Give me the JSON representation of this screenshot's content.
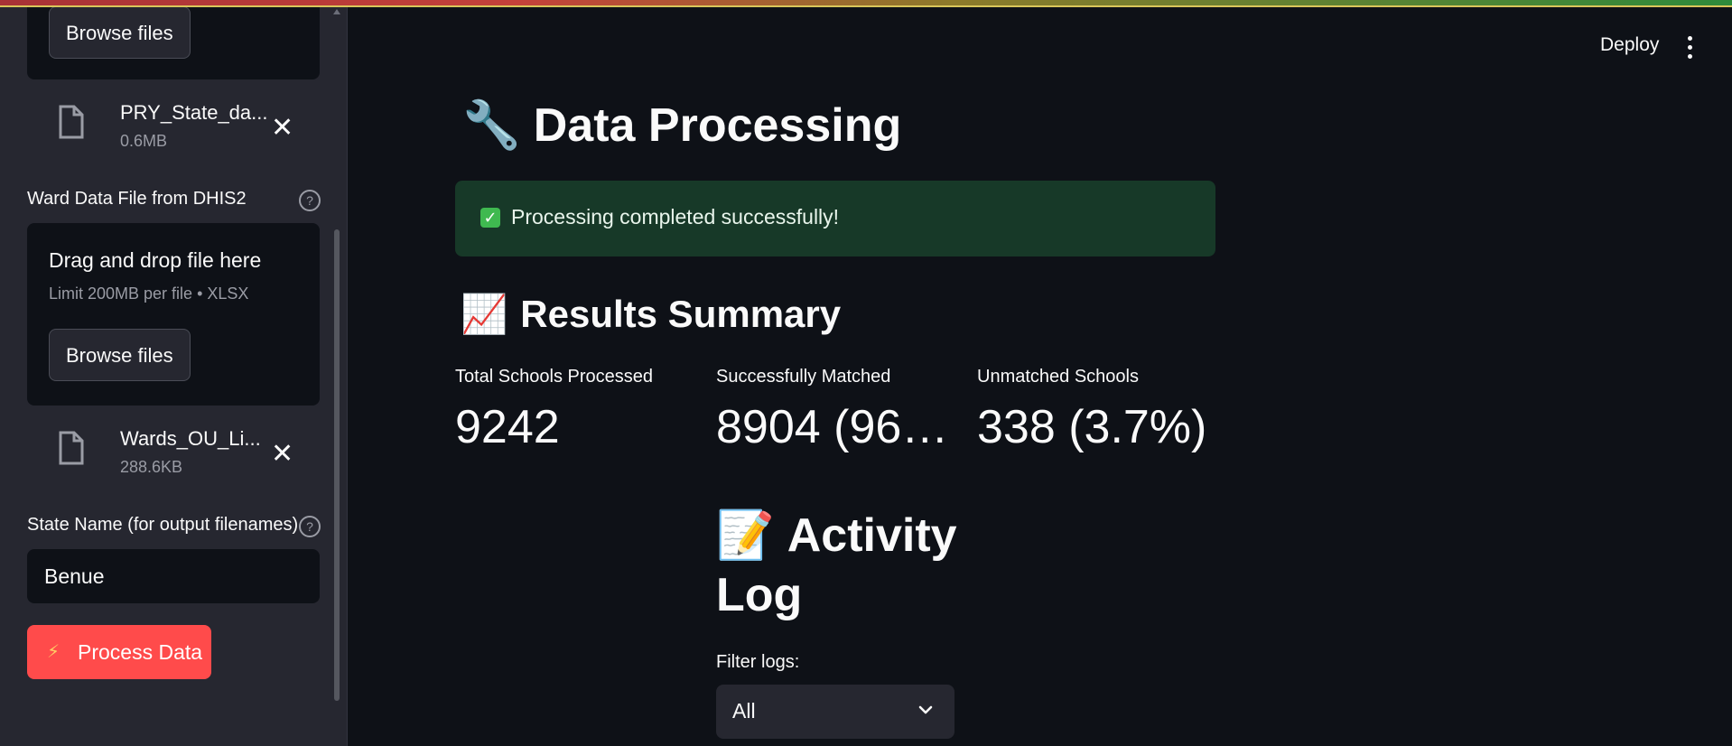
{
  "sidebar": {
    "upload1": {
      "browse_label": "Browse files",
      "file_name": "PRY_State_da...",
      "file_size": "0.6MB"
    },
    "ward_label": "Ward Data File from DHIS2",
    "upload2": {
      "drop_title": "Drag and drop file here",
      "drop_limit": "Limit 200MB per file • XLSX",
      "browse_label": "Browse files",
      "file_name": "Wards_OU_Li...",
      "file_size": "288.6KB"
    },
    "state_label": "State Name (for output filenames)",
    "state_value": "Benue",
    "process_label": "Process Data"
  },
  "header": {
    "deploy_label": "Deploy"
  },
  "main": {
    "title_emoji": "🔧",
    "title": "Data Processing",
    "success_message": "Processing completed successfully!",
    "summary_emoji": "📈",
    "summary_title": "Results Summary",
    "metrics": [
      {
        "label": "Total Schools Processed",
        "value": "9242"
      },
      {
        "label": "Successfully Matched",
        "value": "8904 (96.…"
      },
      {
        "label": "Unmatched Schools",
        "value": "338 (3.7%)"
      }
    ],
    "activity_emoji": "📝",
    "activity_title": "Activity Log",
    "filter_label": "Filter logs:",
    "filter_value": "All"
  },
  "icons": [
    "file-icon",
    "close-icon",
    "help-icon",
    "chevron-down-icon",
    "kebab-menu-icon",
    "lightning-icon",
    "check-icon"
  ],
  "colors": {
    "primary": "#ff4b4b",
    "success_bg": "#173928",
    "background": "#0e1117",
    "sidebar": "#262730"
  }
}
